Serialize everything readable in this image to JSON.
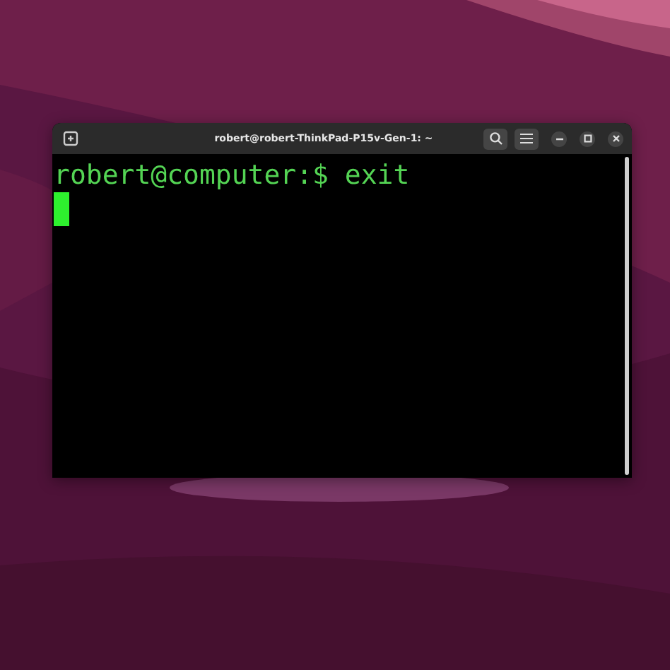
{
  "window": {
    "title": "robert@robert-ThinkPad-P15v-Gen-1: ~"
  },
  "terminal": {
    "lines": [
      "robert@computer:$ exit"
    ]
  }
}
